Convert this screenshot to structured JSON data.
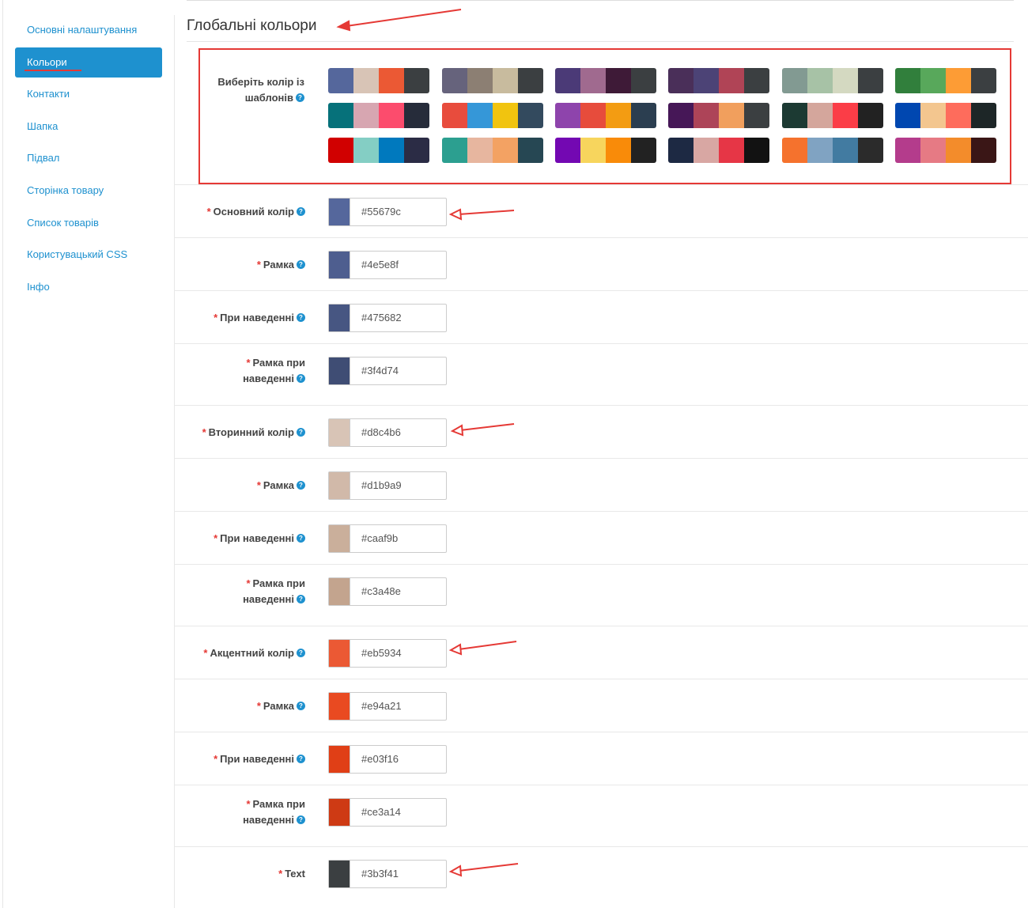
{
  "sidebar": {
    "items": [
      {
        "label": "Основні налаштування",
        "active": false
      },
      {
        "label": "Кольори",
        "active": true
      },
      {
        "label": "Контакти",
        "active": false
      },
      {
        "label": "Шапка",
        "active": false
      },
      {
        "label": "Підвал",
        "active": false
      },
      {
        "label": "Сторінка товару",
        "active": false
      },
      {
        "label": "Список товарів",
        "active": false
      },
      {
        "label": "Користувацький CSS",
        "active": false
      },
      {
        "label": "Інфо",
        "active": false
      }
    ]
  },
  "main": {
    "title": "Глобальні кольори",
    "templates_label": "Виберіть колір із шаблонів",
    "help_glyph": "?",
    "templates": [
      [
        "#55679c",
        "#d8c4b6",
        "#eb5934",
        "#3b3f41"
      ],
      [
        "#66637c",
        "#8c7f73",
        "#c8bb9e",
        "#3b3f41"
      ],
      [
        "#4b3a77",
        "#a06a8f",
        "#3e1a37",
        "#3b3f41"
      ],
      [
        "#4a2f59",
        "#4c4376",
        "#b04456",
        "#3b3f41"
      ],
      [
        "#829a92",
        "#a7c2a6",
        "#d4d9c1",
        "#3b3f41"
      ],
      [
        "#317f3c",
        "#58a85b",
        "#fd9c35",
        "#3b3f41"
      ],
      [
        "#06717a",
        "#d7a6b1",
        "#fc4c6d",
        "#262c3a"
      ],
      [
        "#e84c3d",
        "#3597d8",
        "#f1c40f",
        "#334a5e"
      ],
      [
        "#8e44ac",
        "#e74c3c",
        "#f39c12",
        "#2b3e50"
      ],
      [
        "#461757",
        "#ad4458",
        "#f19f5d",
        "#3b3f41"
      ],
      [
        "#1c3a33",
        "#d4a69c",
        "#fb3d47",
        "#222222"
      ],
      [
        "#0047b0",
        "#f3c68f",
        "#fe6c5c",
        "#1d2627"
      ],
      [
        "#d10000",
        "#84cec4",
        "#0079be",
        "#2b2c45"
      ],
      [
        "#2c9f90",
        "#e7b69f",
        "#f3a263",
        "#264753"
      ],
      [
        "#7308b2",
        "#f7d55d",
        "#f98b09",
        "#222222"
      ],
      [
        "#1d2943",
        "#d8a7a3",
        "#e63646",
        "#121212"
      ],
      [
        "#f5722d",
        "#80a3c2",
        "#427ba1",
        "#2b2b2b"
      ],
      [
        "#b43c8c",
        "#e67a84",
        "#f38c2b",
        "#3a1616"
      ]
    ],
    "fields": [
      {
        "label": "Основний колір",
        "value": "#55679c",
        "help": true
      },
      {
        "label": "Рамка",
        "value": "#4e5e8f",
        "help": true
      },
      {
        "label": "При наведенні",
        "value": "#475682",
        "help": true
      },
      {
        "label": "Рамка при наведенні",
        "line1": "Рамка при",
        "line2": "наведенні",
        "value": "#3f4d74",
        "help": true
      },
      {
        "label": "Вторинний колір",
        "value": "#d8c4b6",
        "help": true
      },
      {
        "label": "Рамка",
        "value": "#d1b9a9",
        "help": true
      },
      {
        "label": "При наведенні",
        "value": "#caaf9b",
        "help": true
      },
      {
        "label": "Рамка при наведенні",
        "line1": "Рамка при",
        "line2": "наведенні",
        "value": "#c3a48e",
        "help": true
      },
      {
        "label": "Акцентний колір",
        "value": "#eb5934",
        "help": true
      },
      {
        "label": "Рамка",
        "value": "#e94a21",
        "help": true
      },
      {
        "label": "При наведенні",
        "value": "#e03f16",
        "help": true
      },
      {
        "label": "Рамка при наведенні",
        "line1": "Рамка при",
        "line2": "наведенні",
        "value": "#ce3a14",
        "help": true
      },
      {
        "label": "Text",
        "value": "#3b3f41",
        "help": false
      }
    ]
  },
  "colors": {
    "accent": "#1e91cf",
    "required": "#e53935",
    "annotation": "#e53935"
  }
}
